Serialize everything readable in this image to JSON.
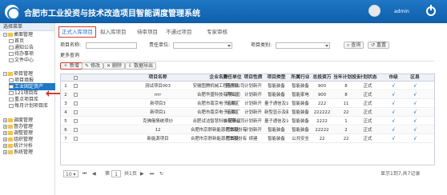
{
  "header": {
    "title": "合肥市工业投资与技术改造项目智能调度管理系统",
    "user": "admin"
  },
  "sidebar": {
    "heading": "选择菜单",
    "items": [
      {
        "label": "桌面管理",
        "level": 0,
        "toggle": "−",
        "icon": "folder"
      },
      {
        "label": "首页",
        "level": 1,
        "icon": "file"
      },
      {
        "label": "通知公告",
        "level": 1,
        "icon": "file"
      },
      {
        "label": "待办事项",
        "level": 1,
        "icon": "file"
      },
      {
        "label": "文件中心",
        "level": 1,
        "icon": "file"
      },
      {
        "label": "项目管理",
        "level": 0,
        "toggle": "−",
        "icon": "folder"
      },
      {
        "label": "项目填报",
        "level": 1,
        "icon": "file"
      },
      {
        "label": "工业固定资产",
        "level": 1,
        "icon": "file",
        "active": true
      },
      {
        "label": "121项目库",
        "level": 1,
        "icon": "file"
      },
      {
        "label": "重点项目库",
        "level": 1,
        "icon": "file"
      },
      {
        "label": "每月计划项目库",
        "level": 1,
        "icon": "file"
      },
      {
        "label": "调度管理",
        "level": 0,
        "toggle": "+",
        "icon": "folder"
      },
      {
        "label": "督办管理",
        "level": 0,
        "toggle": "+",
        "icon": "folder"
      },
      {
        "label": "调整管理",
        "level": 0,
        "toggle": "+",
        "icon": "folder"
      },
      {
        "label": "组织管理",
        "level": 0,
        "toggle": "+",
        "icon": "folder"
      },
      {
        "label": "统计分析",
        "level": 0,
        "toggle": "+",
        "icon": "folder"
      },
      {
        "label": "系统管理",
        "level": 0,
        "toggle": "+",
        "icon": "folder"
      }
    ]
  },
  "tabs": [
    "正式入库项目",
    "拟入库项目",
    "待审项目",
    "不通过项目",
    "专家审核"
  ],
  "filters": {
    "project_name_label": "项目名称:",
    "unit_label": "责任单位:",
    "type_label": "项目类别:",
    "query_button": "查询",
    "reset_button": "重置",
    "more_label": "更多查询"
  },
  "toolbar": {
    "add": "新增",
    "edit": "修改",
    "delete": "删除",
    "export": "数据导出"
  },
  "table": {
    "columns": [
      "项目名称",
      "企业名称",
      "责任单位",
      "项目性质",
      "项目类型",
      "所属行业",
      "总投资万",
      "当年计划投资",
      "计划状态",
      "市级",
      "区县"
    ],
    "rows": [
      [
        "测试项目003",
        "安徽图腾机械工程有限公司",
        "肥东县",
        "计划新开",
        "智能装备",
        "智能装备",
        "900",
        "8",
        "正式",
        "√",
        "√"
      ],
      [
        "rrrr",
        "合肥华盛科技有限公司",
        "庐阳区",
        "计划新开",
        "智能装备",
        "智能家电",
        "900",
        "8",
        "正式",
        "√",
        "√"
      ],
      [
        "新项目3",
        "合肥市南京电子元件厂",
        "瑶海区",
        "计划新开",
        "量子通信及公共",
        "智能装备",
        "222",
        "11",
        "正式",
        "√",
        "√"
      ],
      [
        "新项目1",
        "合肥市南京电子元件厂",
        "瑶海区",
        "计划新开",
        "新型显示及新",
        "智能装备",
        "222222",
        "22",
        "正式",
        "√",
        "√"
      ],
      [
        "克佛俄情统项炒",
        "合肥试洁智慧科技有限公司",
        "合肥新区",
        "计划新开",
        "量子通信及公共",
        "智能装备",
        "2222",
        "1",
        "正式",
        "√",
        "√"
      ],
      [
        "12",
        "合肥市京舒新能源汽车股份有限",
        "肥西县",
        "计划新开",
        "智能装备",
        "智能装备",
        "22222",
        "2",
        "正式",
        "√",
        "√"
      ],
      [
        "新能源项目",
        "合肥市京舒新能源汽车股份有限",
        "肥西县",
        "续建",
        "智能装备",
        "公共安全",
        "22",
        "22",
        "正式",
        "√",
        "√"
      ]
    ]
  },
  "pager": {
    "page_size": "10",
    "page_label": "第",
    "current_page": "1",
    "total_label": "共1页",
    "summary": "显示1到7,共7记录"
  },
  "colors": {
    "primary": "#1f77c6",
    "highlight": "#d93a2b"
  }
}
